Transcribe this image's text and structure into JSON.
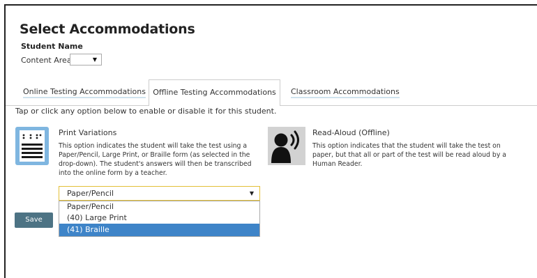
{
  "page": {
    "title": "Select Accommodations",
    "student_name_label": "Student Name",
    "content_area_label": "Content Area",
    "content_area_value": ""
  },
  "tabs": {
    "online": "Online Testing Accommodations",
    "offline": "Offline Testing Accommodations",
    "classroom": "Classroom Accommodations",
    "active": "offline"
  },
  "instruction": "Tap or click any option below to enable or disable it for this student.",
  "print_variations": {
    "icon": "braille-list-icon",
    "title": "Print Variations",
    "description": "This option indicates the student will take the test using a Paper/Pencil, Large Print, or Braille form (as selected in the drop-down). The student's answers will then be transcribed into the online form by a teacher.",
    "selected_value": "Paper/Pencil",
    "options": [
      "Paper/Pencil",
      "(40) Large Print",
      "(41) Braille"
    ],
    "highlighted_option": "(41) Braille"
  },
  "read_aloud": {
    "icon": "speaking-head-icon",
    "title": "Read-Aloud (Offline)",
    "description": "This option indicates that the student will take the test on paper, but that all or part of the test will be read aloud by a Human Reader."
  },
  "save_label": "Save",
  "colors": {
    "save_button": "#4d7384",
    "print_icon_bg": "#7fb6e0",
    "highlight": "#3e84c8",
    "select_border": "#e3bf36"
  }
}
